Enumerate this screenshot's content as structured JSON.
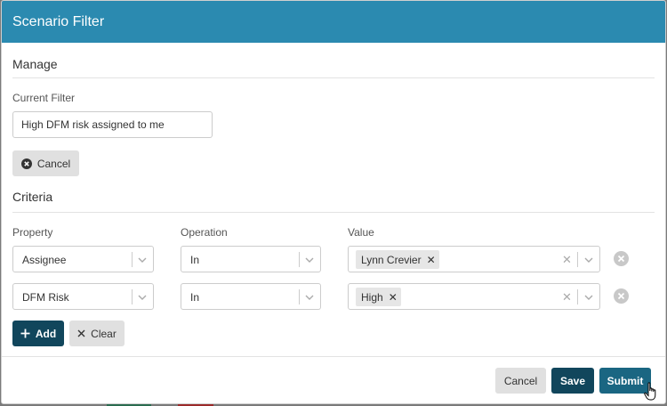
{
  "dialog": {
    "title": "Scenario Filter"
  },
  "manage": {
    "section_title": "Manage",
    "current_filter_label": "Current Filter",
    "current_filter_value": "High DFM risk assigned to me",
    "cancel_label": "Cancel"
  },
  "criteria": {
    "section_title": "Criteria",
    "headers": {
      "property": "Property",
      "operation": "Operation",
      "value": "Value"
    },
    "rows": [
      {
        "property": "Assignee",
        "operation": "In",
        "values": [
          "Lynn Crevier"
        ]
      },
      {
        "property": "DFM Risk",
        "operation": "In",
        "values": [
          "High"
        ]
      }
    ],
    "add_label": "Add",
    "clear_label": "Clear"
  },
  "footer": {
    "cancel_label": "Cancel",
    "save_label": "Save",
    "submit_label": "Submit"
  },
  "colors": {
    "header": "#2b8ab0",
    "primary_dark": "#11465c",
    "primary_teal": "#1a6682"
  }
}
